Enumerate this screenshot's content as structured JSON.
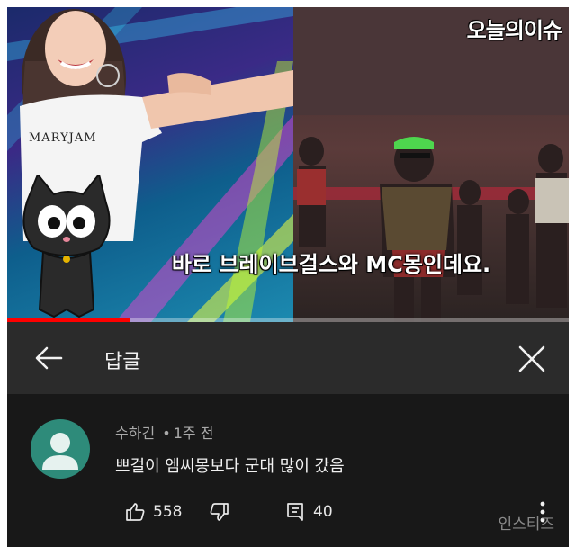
{
  "video": {
    "channel_logo": "오늘의이슈",
    "subtitle": "바로 브레이브걸스와 MC몽인데요.",
    "shirt_text": "MARYJAM",
    "progress": 0.22,
    "progress_color": "#ff0000"
  },
  "header": {
    "back_icon": "arrow-left-icon",
    "title": "답글",
    "close_icon": "close-icon"
  },
  "comment": {
    "avatar_color": "#2e8b7a",
    "author": "수하긴",
    "separator": "•",
    "time": "1주 전",
    "text": "쁘걸이 엠씨몽보다 군대 많이 갔음",
    "likes": "558",
    "reply_count": "40",
    "icons": [
      "thumb-up-icon",
      "thumb-down-icon",
      "reply-icon",
      "more-vert-icon"
    ]
  },
  "watermark": "인스티즈"
}
